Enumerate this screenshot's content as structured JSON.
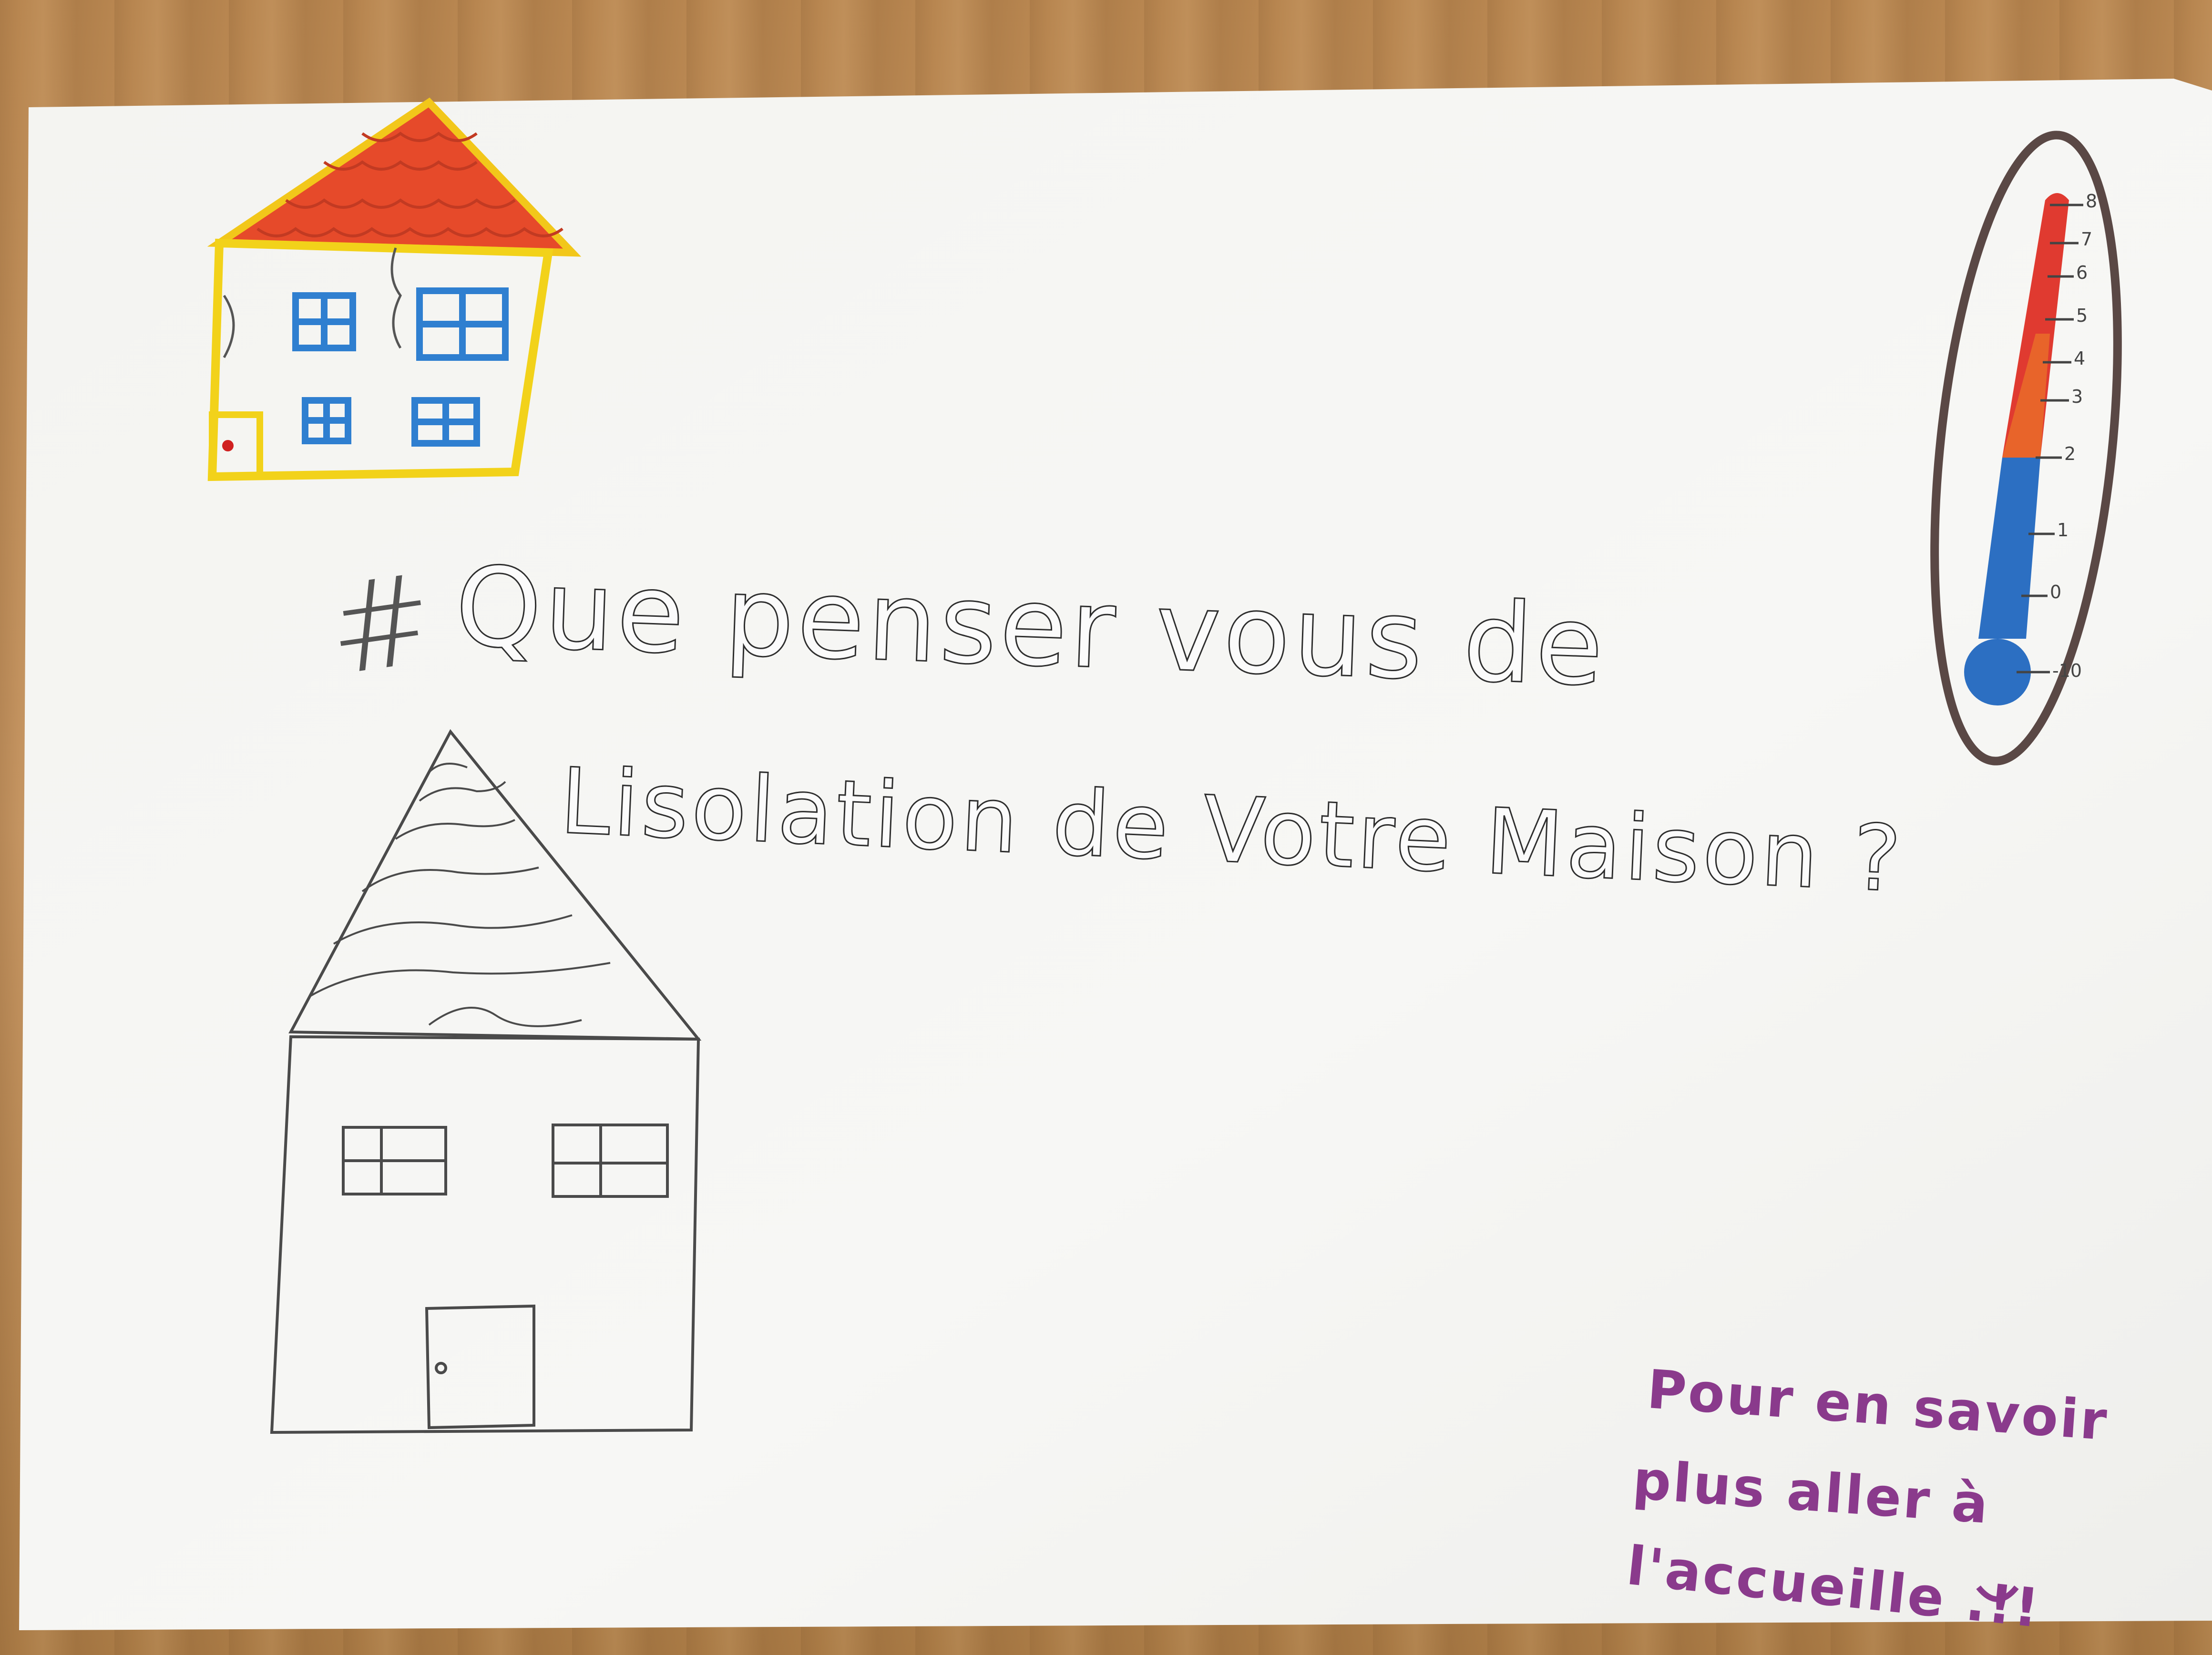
{
  "poster": {
    "title_line1_hash": "#",
    "title_line1_text": "Que penser vous de",
    "title_line2_text": "Lisolation de Votre Maison ?",
    "note_line1": "Pour en savoir",
    "note_line2": "plus aller à",
    "note_line3": "l'accueille .!!"
  },
  "thermometer": {
    "tick_labels": [
      "8",
      "7",
      "6",
      "5",
      "4",
      "3",
      "2",
      "1",
      "0",
      "-10"
    ]
  },
  "colors": {
    "wood": "#b98a52",
    "paper": "#f6f6f4",
    "roof_red": "#e64a2a",
    "wall_yellow": "#f2d21a",
    "window_blue": "#2f7fd0",
    "pencil": "#4a4a4a",
    "thermo_red": "#e03a30",
    "thermo_blue": "#2c6fc2",
    "outline_brown": "#5a4845",
    "note_purple": "#8a3a8c"
  }
}
